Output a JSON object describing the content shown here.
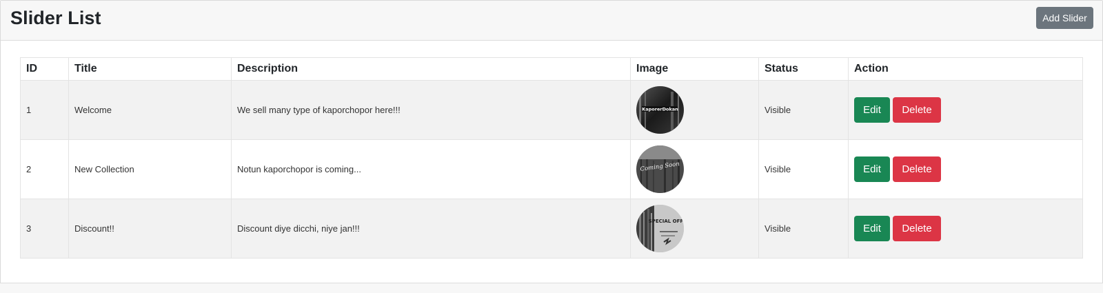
{
  "header": {
    "title": "Slider List",
    "add_button": "Add Slider"
  },
  "table": {
    "columns": [
      "ID",
      "Title",
      "Description",
      "Image",
      "Status",
      "Action"
    ],
    "rows": [
      {
        "id": "1",
        "title": "Welcome",
        "description": "We sell many type of kaporchopor here!!!",
        "image_text": "KaporerDokan",
        "status": "Visible",
        "edit": "Edit",
        "delete": "Delete"
      },
      {
        "id": "2",
        "title": "New Collection",
        "description": "Notun kaporchopor is coming...",
        "image_text": "Coming Soon",
        "status": "Visible",
        "edit": "Edit",
        "delete": "Delete"
      },
      {
        "id": "3",
        "title": "Discount!!",
        "description": "Discount diye dicchi, niye jan!!!",
        "image_text": "SPECIAL OFFER",
        "status": "Visible",
        "edit": "Edit",
        "delete": "Delete"
      }
    ]
  },
  "colors": {
    "edit_button": "#198754",
    "delete_button": "#dc3545",
    "add_button": "#6c757d",
    "header_bg": "#f7f7f7",
    "stripe_bg": "#f2f2f2"
  }
}
